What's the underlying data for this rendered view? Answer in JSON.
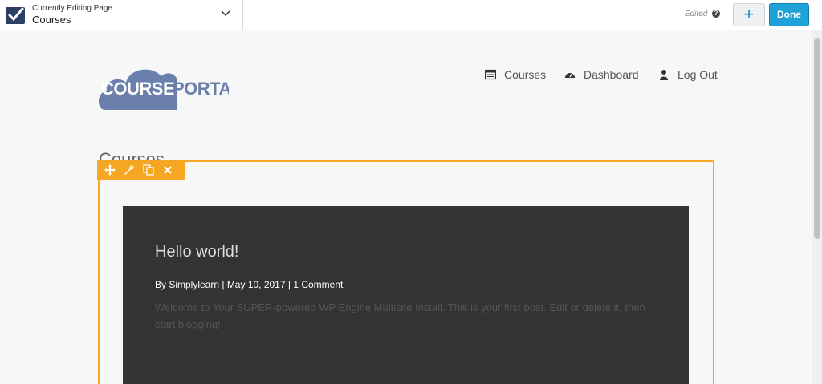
{
  "topbar": {
    "editing_label": "Currently Editing Page",
    "page_name": "Courses",
    "status": "Edited",
    "help_glyph": "?",
    "add_label": "+",
    "done_label": "Done"
  },
  "site": {
    "logo_text_left": "COURSE",
    "logo_text_right": "PORTAL",
    "nav": [
      {
        "label": "Courses",
        "icon": "table-list-icon"
      },
      {
        "label": "Dashboard",
        "icon": "dashboard-gauge-icon"
      },
      {
        "label": "Log Out",
        "icon": "user-icon"
      }
    ]
  },
  "content": {
    "title": "Courses",
    "module_tools": [
      "move-icon",
      "wrench-icon",
      "copy-icon",
      "close-icon"
    ],
    "post": {
      "title": "Hello world!",
      "meta_by": "By Simplylearn | May 10, 2017 | 1 Comment",
      "excerpt": "Welcome to Your SUPER-powered WP Engine Multisite Install. This is your first post. Edit or delete it, then start blogging!"
    }
  },
  "colors": {
    "accent": "#f5a623",
    "done_button": "#1ea2d8",
    "logo": "#6a7fab",
    "post_bg": "#333333"
  }
}
